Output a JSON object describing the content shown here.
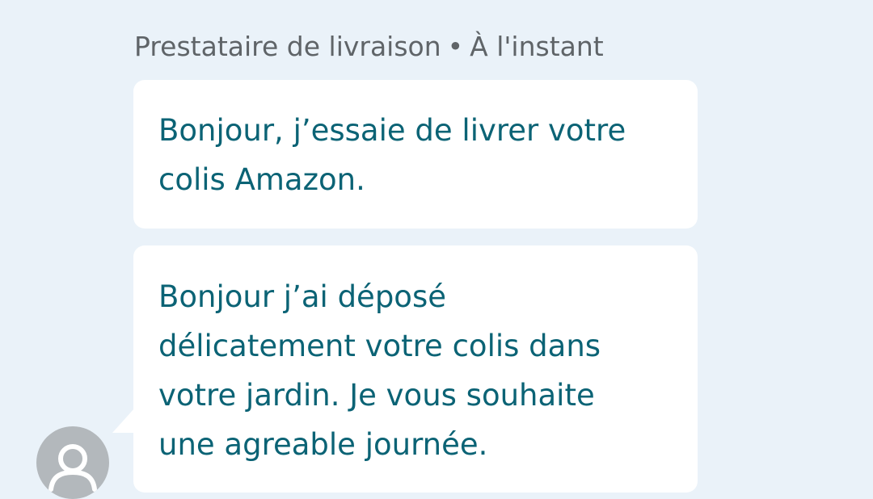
{
  "header": {
    "sender": "Prestataire de livraison",
    "separator": "•",
    "time": "À l'instant"
  },
  "messages": [
    {
      "line1": "Bonjour, j’essaie de livrer votre",
      "line2": "colis Amazon."
    },
    {
      "line1": "Bonjour j’ai déposé",
      "line2": "délicatement votre colis dans",
      "line3": "votre jardin. Je vous souhaite",
      "line4": "une agreable journée."
    }
  ],
  "avatar": {
    "icon": "user-avatar-icon",
    "background": "#b3b8bc"
  },
  "colors": {
    "background": "#eaf2f9",
    "bubble": "#ffffff",
    "message_text": "#0b6375",
    "meta_text": "#5f6468"
  }
}
